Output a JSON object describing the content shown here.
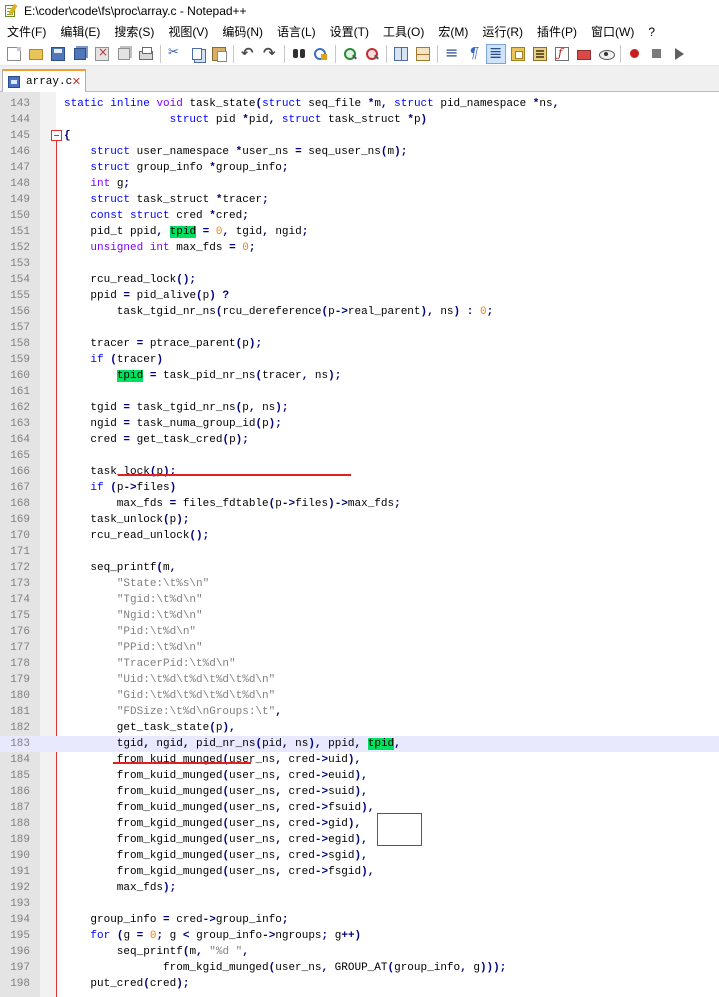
{
  "window": {
    "title": "E:\\coder\\code\\fs\\proc\\array.c - Notepad++"
  },
  "menu": [
    "文件(F)",
    "编辑(E)",
    "搜索(S)",
    "视图(V)",
    "编码(N)",
    "语言(L)",
    "设置(T)",
    "工具(O)",
    "宏(M)",
    "运行(R)",
    "插件(P)",
    "窗口(W)",
    "?"
  ],
  "toolbar": {
    "icons": [
      "new-file-icon",
      "open-file-icon",
      "save-icon",
      "save-all-icon",
      "close-icon",
      "close-all-icon",
      "print-icon",
      "cut-icon",
      "copy-icon",
      "paste-icon",
      "undo-icon",
      "redo-icon",
      "find-icon",
      "replace-icon",
      "zoom-in-icon",
      "zoom-out-icon",
      "sync-vertical-icon",
      "sync-horizontal-icon",
      "word-wrap-icon",
      "show-all-chars-icon",
      "indent-guide-icon",
      "user-defined-language-icon",
      "document-map-icon",
      "function-list-icon",
      "folder-as-workspace-icon",
      "monitoring-icon",
      "record-macro-icon",
      "stop-recording-icon",
      "playback-icon"
    ]
  },
  "tabs": [
    {
      "label": "array.c",
      "active": true
    }
  ],
  "editor": {
    "highlight_color": "#00e060",
    "current_line": 183,
    "lines": [
      {
        "n": "143",
        "html": "<span class='k'>static</span> <span class='k'>inline</span> <span class='t'>void</span> task_state<span class='o'>(</span><span class='k'>struct</span> seq_file <span class='o'>*</span>m<span class='o'>,</span> <span class='k'>struct</span> pid_namespace <span class='o'>*</span>ns<span class='o'>,</span>"
      },
      {
        "n": "144",
        "html": "                <span class='k'>struct</span> pid <span class='o'>*</span>pid<span class='o'>,</span> <span class='k'>struct</span> task_struct <span class='o'>*</span>p<span class='o'>)</span>"
      },
      {
        "n": "145",
        "html": "<span class='o'>{</span>"
      },
      {
        "n": "146",
        "html": "    <span class='k'>struct</span> user_namespace <span class='o'>*</span>user_ns <span class='o'>=</span> seq_user_ns<span class='o'>(</span>m<span class='o'>);</span>"
      },
      {
        "n": "147",
        "html": "    <span class='k'>struct</span> group_info <span class='o'>*</span>group_info<span class='o'>;</span>"
      },
      {
        "n": "148",
        "html": "    <span class='t'>int</span> g<span class='o'>;</span>"
      },
      {
        "n": "149",
        "html": "    <span class='k'>struct</span> task_struct <span class='o'>*</span>tracer<span class='o'>;</span>"
      },
      {
        "n": "150",
        "html": "    <span class='k'>const</span> <span class='k'>struct</span> cred <span class='o'>*</span>cred<span class='o'>;</span>"
      },
      {
        "n": "151",
        "html": "    pid_t ppid<span class='o'>,</span> <span class='hl'>tpid</span> <span class='o'>=</span> <span class='n'>0</span><span class='o'>,</span> tgid<span class='o'>,</span> ngid<span class='o'>;</span>"
      },
      {
        "n": "152",
        "html": "    <span class='t'>unsigned</span> <span class='t'>int</span> max_fds <span class='o'>=</span> <span class='n'>0</span><span class='o'>;</span>"
      },
      {
        "n": "153",
        "html": ""
      },
      {
        "n": "154",
        "html": "    rcu_read_lock<span class='o'>();</span>"
      },
      {
        "n": "155",
        "html": "    ppid <span class='o'>=</span> pid_alive<span class='o'>(</span>p<span class='o'>)</span> <span class='o'>?</span>"
      },
      {
        "n": "156",
        "html": "        task_tgid_nr_ns<span class='o'>(</span>rcu_dereference<span class='o'>(</span>p<span class='o'>-&gt;</span>real_parent<span class='o'>),</span> ns<span class='o'>)</span> <span class='o'>:</span> <span class='n'>0</span><span class='o'>;</span>"
      },
      {
        "n": "157",
        "html": ""
      },
      {
        "n": "158",
        "html": "    tracer <span class='o'>=</span> ptrace_parent<span class='o'>(</span>p<span class='o'>);</span>"
      },
      {
        "n": "159",
        "html": "    <span class='k'>if</span> <span class='o'>(</span>tracer<span class='o'>)</span>"
      },
      {
        "n": "160",
        "html": "        <span class='hl'>tpid</span> <span class='o'>=</span> task_pid_nr_ns<span class='o'>(</span>tracer<span class='o'>,</span> ns<span class='o'>);</span>"
      },
      {
        "n": "161",
        "html": ""
      },
      {
        "n": "162",
        "html": "    tgid <span class='o'>=</span> task_tgid_nr_ns<span class='o'>(</span>p<span class='o'>,</span> ns<span class='o'>);</span>"
      },
      {
        "n": "163",
        "html": "    ngid <span class='o'>=</span> task_numa_group_id<span class='o'>(</span>p<span class='o'>);</span>"
      },
      {
        "n": "164",
        "html": "    cred <span class='o'>=</span> get_task_cred<span class='o'>(</span>p<span class='o'>);</span>"
      },
      {
        "n": "165",
        "html": ""
      },
      {
        "n": "166",
        "html": "    task_lock<span class='o'>(</span>p<span class='o'>);</span>"
      },
      {
        "n": "167",
        "html": "    <span class='k'>if</span> <span class='o'>(</span>p<span class='o'>-&gt;</span>files<span class='o'>)</span>"
      },
      {
        "n": "168",
        "html": "        max_fds <span class='o'>=</span> files_fdtable<span class='o'>(</span>p<span class='o'>-&gt;</span>files<span class='o'>)-&gt;</span>max_fds<span class='o'>;</span>"
      },
      {
        "n": "169",
        "html": "    task_unlock<span class='o'>(</span>p<span class='o'>);</span>"
      },
      {
        "n": "170",
        "html": "    rcu_read_unlock<span class='o'>();</span>"
      },
      {
        "n": "171",
        "html": ""
      },
      {
        "n": "172",
        "html": "    seq_printf<span class='o'>(</span>m<span class='o'>,</span>"
      },
      {
        "n": "173",
        "html": "        <span class='s'>\"State:\\t%s\\n\"</span>"
      },
      {
        "n": "174",
        "html": "        <span class='s'>\"Tgid:\\t%d\\n\"</span>"
      },
      {
        "n": "175",
        "html": "        <span class='s'>\"Ngid:\\t%d\\n\"</span>"
      },
      {
        "n": "176",
        "html": "        <span class='s'>\"Pid:\\t%d\\n\"</span>"
      },
      {
        "n": "177",
        "html": "        <span class='s'>\"PPid:\\t%d\\n\"</span>"
      },
      {
        "n": "178",
        "html": "        <span class='s'>\"TracerPid:\\t%d\\n\"</span>"
      },
      {
        "n": "179",
        "html": "        <span class='s'>\"Uid:\\t%d\\t%d\\t%d\\t%d\\n\"</span>"
      },
      {
        "n": "180",
        "html": "        <span class='s'>\"Gid:\\t%d\\t%d\\t%d\\t%d\\n\"</span>"
      },
      {
        "n": "181",
        "html": "        <span class='s'>\"FDSize:\\t%d\\nGroups:\\t\"</span><span class='o'>,</span>"
      },
      {
        "n": "182",
        "html": "        get_task_state<span class='o'>(</span>p<span class='o'>),</span>"
      },
      {
        "n": "183",
        "html": "        tgid<span class='o'>,</span> ngid<span class='o'>,</span> pid_nr_ns<span class='o'>(</span>pid<span class='o'>,</span> ns<span class='o'>),</span> ppid<span class='o'>,</span> <span class='hl'>tpid</span><span class='o'>,</span>"
      },
      {
        "n": "184",
        "html": "        from_kuid_munged<span class='o'>(</span>user_ns<span class='o'>,</span> cred<span class='o'>-&gt;</span>uid<span class='o'>),</span>"
      },
      {
        "n": "185",
        "html": "        from_kuid_munged<span class='o'>(</span>user_ns<span class='o'>,</span> cred<span class='o'>-&gt;</span>euid<span class='o'>),</span>"
      },
      {
        "n": "186",
        "html": "        from_kuid_munged<span class='o'>(</span>user_ns<span class='o'>,</span> cred<span class='o'>-&gt;</span>suid<span class='o'>),</span>"
      },
      {
        "n": "187",
        "html": "        from_kuid_munged<span class='o'>(</span>user_ns<span class='o'>,</span> cred<span class='o'>-&gt;</span>fsuid<span class='o'>),</span>"
      },
      {
        "n": "188",
        "html": "        from_kgid_munged<span class='o'>(</span>user_ns<span class='o'>,</span> cred<span class='o'>-&gt;</span>gid<span class='o'>),</span>"
      },
      {
        "n": "189",
        "html": "        from_kgid_munged<span class='o'>(</span>user_ns<span class='o'>,</span> cred<span class='o'>-&gt;</span>egid<span class='o'>),</span>"
      },
      {
        "n": "190",
        "html": "        from_kgid_munged<span class='o'>(</span>user_ns<span class='o'>,</span> cred<span class='o'>-&gt;</span>sgid<span class='o'>),</span>"
      },
      {
        "n": "191",
        "html": "        from_kgid_munged<span class='o'>(</span>user_ns<span class='o'>,</span> cred<span class='o'>-&gt;</span>fsgid<span class='o'>),</span>"
      },
      {
        "n": "192",
        "html": "        max_fds<span class='o'>);</span>"
      },
      {
        "n": "193",
        "html": ""
      },
      {
        "n": "194",
        "html": "    group_info <span class='o'>=</span> cred<span class='o'>-&gt;</span>group_info<span class='o'>;</span>"
      },
      {
        "n": "195",
        "html": "    <span class='k'>for</span> <span class='o'>(</span>g <span class='o'>=</span> <span class='n'>0</span><span class='o'>;</span> g <span class='o'>&lt;</span> group_info<span class='o'>-&gt;</span>ngroups<span class='o'>;</span> g<span class='o'>++)</span>"
      },
      {
        "n": "196",
        "html": "        seq_printf<span class='o'>(</span>m<span class='o'>,</span> <span class='s'>\"%d \"</span><span class='o'>,</span>"
      },
      {
        "n": "197",
        "html": "               from_kgid_munged<span class='o'>(</span>user_ns<span class='o'>,</span> GROUP_AT<span class='o'>(</span>group_info<span class='o'>,</span> g<span class='o'>)));</span>"
      },
      {
        "n": "198",
        "html": "    put_cred<span class='o'>(</span>cred<span class='o'>);</span>"
      }
    ]
  }
}
